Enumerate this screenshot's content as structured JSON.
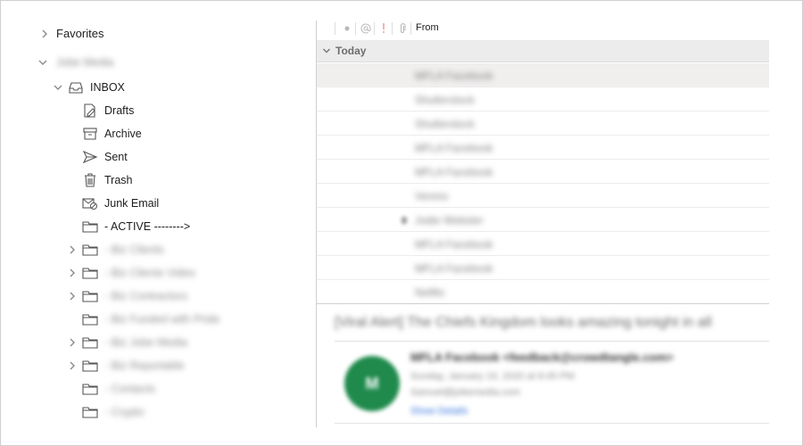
{
  "sidebar": {
    "favorites_label": "Favorites",
    "account_label": "Jobe Media",
    "inbox_label": "INBOX",
    "folders": [
      {
        "label": "Drafts",
        "icon": "drafts-icon"
      },
      {
        "label": "Archive",
        "icon": "archive-icon"
      },
      {
        "label": "Sent",
        "icon": "sent-icon"
      },
      {
        "label": "Trash",
        "icon": "trash-icon"
      },
      {
        "label": "Junk Email",
        "icon": "junk-icon"
      },
      {
        "label": "- ACTIVE -------->",
        "icon": "folder-icon"
      }
    ],
    "blurred_folders": [
      {
        "label": "- Biz Clients",
        "expandable": true
      },
      {
        "label": "- Biz Clients Video",
        "expandable": true
      },
      {
        "label": "- Biz Contractors",
        "expandable": true
      },
      {
        "label": "- Biz Funded with Pride",
        "expandable": false
      },
      {
        "label": "- Biz Jobe Media",
        "expandable": true
      },
      {
        "label": "- Biz Reportable",
        "expandable": true
      },
      {
        "label": "- Contacts",
        "expandable": false
      },
      {
        "label": "- Crypto",
        "expandable": false
      }
    ]
  },
  "message_list": {
    "columns": {
      "status_icon": "dot-icon",
      "mention_icon": "at-icon",
      "priority_icon": "exclamation-icon",
      "attachment_icon": "paperclip-icon",
      "from_label": "From"
    },
    "group_label": "Today",
    "messages": [
      {
        "sender": "MFLA Facebook"
      },
      {
        "sender": "Shutterstock"
      },
      {
        "sender": "Shutterstock"
      },
      {
        "sender": "MFLA Facebook"
      },
      {
        "sender": "MFLA Facebook"
      },
      {
        "sender": "Venmo"
      },
      {
        "sender": "Jodie Webster"
      },
      {
        "sender": "MFLA Facebook"
      },
      {
        "sender": "MFLA Facebook"
      },
      {
        "sender": "Netflix"
      }
    ]
  },
  "preview": {
    "subject": "[Viral Alert] The Chiefs Kingdom looks amazing tonight in all",
    "avatar_initials": "M",
    "from": "MFLA Facebook <feedback@crowdtangle.com>",
    "date": "Sunday, January 19, 2020 at 8:45 PM",
    "to": "Samuel@jobemedia.com",
    "details_link": "Show Details"
  },
  "colors": {
    "selected_row": "#f0efee",
    "group_header": "#ececec",
    "avatar": "#1f8a4c",
    "link": "#2a6fdb"
  }
}
